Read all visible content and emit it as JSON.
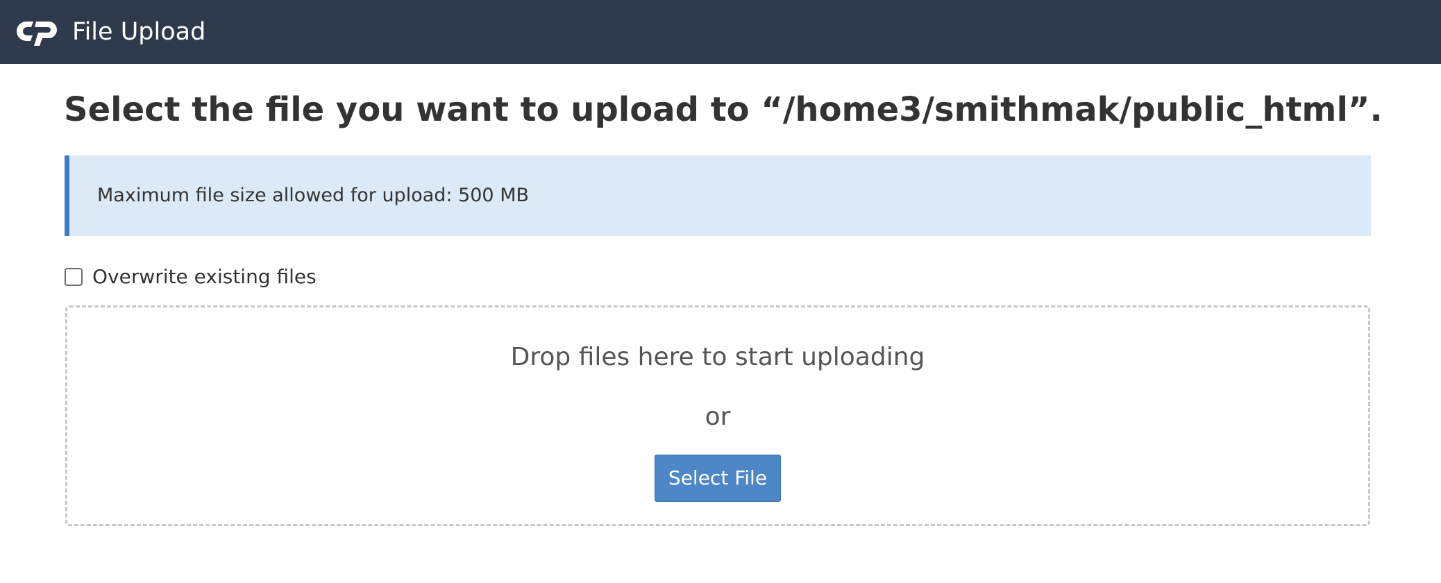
{
  "header": {
    "logo_icon": "cpanel-logo-icon",
    "title": "File Upload"
  },
  "main": {
    "heading": "Select the file you want to upload to “/home3/smithmak/public_html”.",
    "info_alert": "Maximum file size allowed for upload: 500 MB",
    "overwrite_checkbox": {
      "label": "Overwrite existing files",
      "checked": false
    },
    "dropzone": {
      "prompt": "Drop files here to start uploading",
      "or_text": "or",
      "button_label": "Select File"
    }
  },
  "colors": {
    "topbar": "#2e3a4b",
    "alert_background": "#dbeaf6",
    "alert_border": "#3d7cc1",
    "button": "#4d87c7"
  }
}
